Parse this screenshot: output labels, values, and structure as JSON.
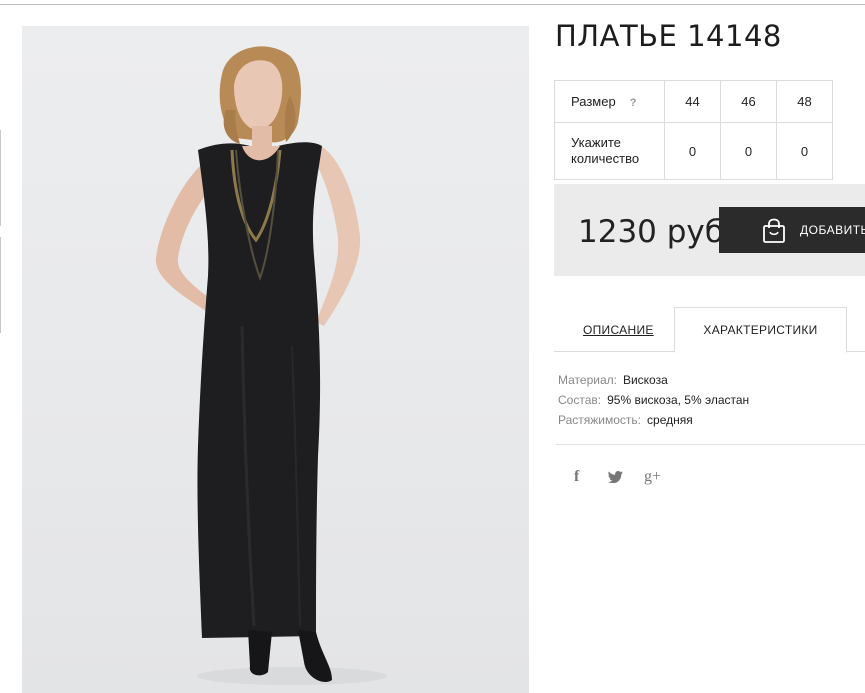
{
  "product": {
    "title": "ПЛАТЬЕ 14148",
    "image_alt": "black sleeveless maxi dress with layered chain necklace"
  },
  "size_table": {
    "size_label": "Размер",
    "help_mark": "?",
    "sizes": [
      "44",
      "46",
      "48"
    ],
    "quantity_label": "Укажите количество",
    "quantities": [
      "0",
      "0",
      "0"
    ]
  },
  "purchase": {
    "price": "1230 руб",
    "add_button": "ДОБАВИТЬ"
  },
  "tabs": {
    "description": "ОПИСАНИЕ",
    "characteristics": "ХАРАКТЕРИСТИКИ",
    "active": "characteristics"
  },
  "specs": [
    {
      "key": "Материал:",
      "value": "Вискоза"
    },
    {
      "key": "Состав:",
      "value": "95% вискоза, 5% эластан"
    },
    {
      "key": "Растяжимость:",
      "value": "средняя"
    }
  ],
  "social": {
    "facebook": "f",
    "twitter": "twitter-bird",
    "googleplus": "g+"
  },
  "colors": {
    "button_bg": "#2b2b2b",
    "price_box_bg": "#ebebeb",
    "photo_bg": "#eaebed"
  }
}
